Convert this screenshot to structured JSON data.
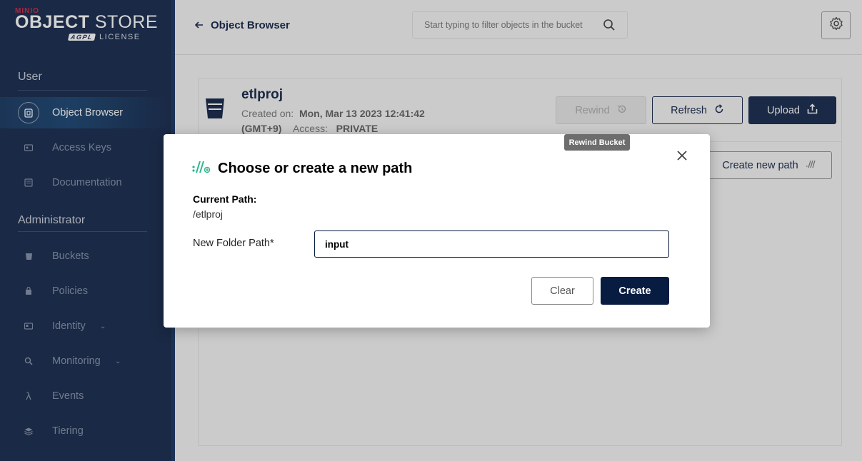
{
  "sidebar": {
    "logo": {
      "brand": "MINIO",
      "product_bold": "OBJECT",
      "product_rest": " STORE",
      "agpl": "AGPL",
      "license": "LICENSE"
    },
    "sections": [
      {
        "title": "User"
      },
      {
        "title": "Administrator"
      }
    ],
    "items": [
      {
        "label": "Object Browser",
        "icon": "object-browser-icon"
      },
      {
        "label": "Access Keys",
        "icon": "key-icon"
      },
      {
        "label": "Documentation",
        "icon": "document-icon"
      },
      {
        "label": "Buckets",
        "icon": "bucket-icon"
      },
      {
        "label": "Policies",
        "icon": "policy-icon"
      },
      {
        "label": "Identity",
        "icon": "identity-icon"
      },
      {
        "label": "Monitoring",
        "icon": "monitoring-icon"
      },
      {
        "label": "Events",
        "icon": "lambda-icon"
      },
      {
        "label": "Tiering",
        "icon": "layers-icon"
      }
    ]
  },
  "topbar": {
    "back_label": "Object Browser",
    "search_placeholder": "Start typing to filter objects in the bucket"
  },
  "bucket": {
    "name": "etlproj",
    "created_label": "Created on:",
    "created_value": "Mon, Mar 13 2023 12:41:42",
    "timezone": "(GMT+9)",
    "access_label": "Access:",
    "access_value": "PRIVATE"
  },
  "actions": {
    "rewind": "Rewind",
    "refresh": "Refresh",
    "upload": "Upload",
    "create_new_path": "Create new path"
  },
  "tooltip": "Rewind Bucket",
  "modal": {
    "title": "Choose or create a new path",
    "current_path_label": "Current Path:",
    "current_path_value": "/etlproj",
    "new_folder_label": "New Folder Path*",
    "new_folder_value": "input",
    "clear": "Clear",
    "create": "Create"
  },
  "colors": {
    "brand_navy": "#081c42",
    "logo_red": "#c51d3a",
    "path_icon_green": "#2fb58e"
  }
}
